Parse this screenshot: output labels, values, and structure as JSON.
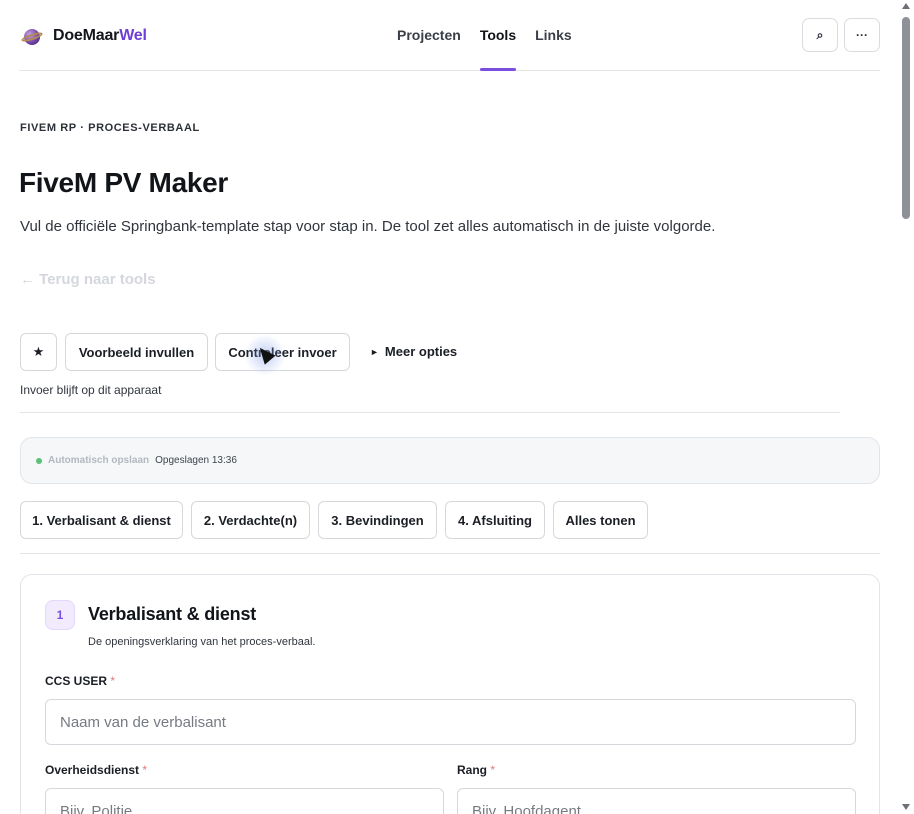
{
  "brand": {
    "name_main": "DoeMaar",
    "name_accent": "Wel"
  },
  "nav": {
    "items": [
      {
        "label": "Projecten",
        "active": false
      },
      {
        "label": "Tools",
        "active": true
      },
      {
        "label": "Links",
        "active": false
      }
    ],
    "search_icon_glyph": "⌕",
    "more_icon_glyph": "···"
  },
  "intro": {
    "eyebrow": "FIVEM RP · PROCES-VERBAAL",
    "title": "FiveM PV Maker",
    "subtitle": "Vul de officiële Springbank-template stap voor stap in. De tool zet alles automatisch in de juiste volgorde.",
    "back_link": "← Terug naar tools"
  },
  "actions": {
    "star_glyph": "★",
    "example_label": "Voorbeeld invullen",
    "check_label": "Controleer invoer",
    "more_glyph": "►",
    "more_label": "Meer opties",
    "local_note": "Invoer blijft op dit apparaat"
  },
  "autosave": {
    "label": "Automatisch opslaan",
    "status": "Opgeslagen 13:36",
    "status_color": "#5cc07a"
  },
  "steps": [
    "1. Verbalisant & dienst",
    "2. Verdachte(n)",
    "3. Bevindingen",
    "4. Afsluiting",
    "Alles tonen"
  ],
  "card": {
    "number": "1",
    "title": "Verbalisant & dienst",
    "description": "De openingsverklaring van het proces-verbaal.",
    "required_marker": "*",
    "fields": {
      "ccs_user": {
        "label": "CCS USER",
        "placeholder": "Naam van de verbalisant",
        "value": ""
      },
      "overheidsdienst": {
        "label": "Overheidsdienst",
        "placeholder": "Bijv. Politie",
        "value": ""
      },
      "rang": {
        "label": "Rang",
        "placeholder": "Bijv. Hoofdagent",
        "value": ""
      }
    }
  },
  "colors": {
    "accent": "#7b4ee0",
    "brand_accent": "#6d3fd6",
    "required": "#e0787a"
  }
}
